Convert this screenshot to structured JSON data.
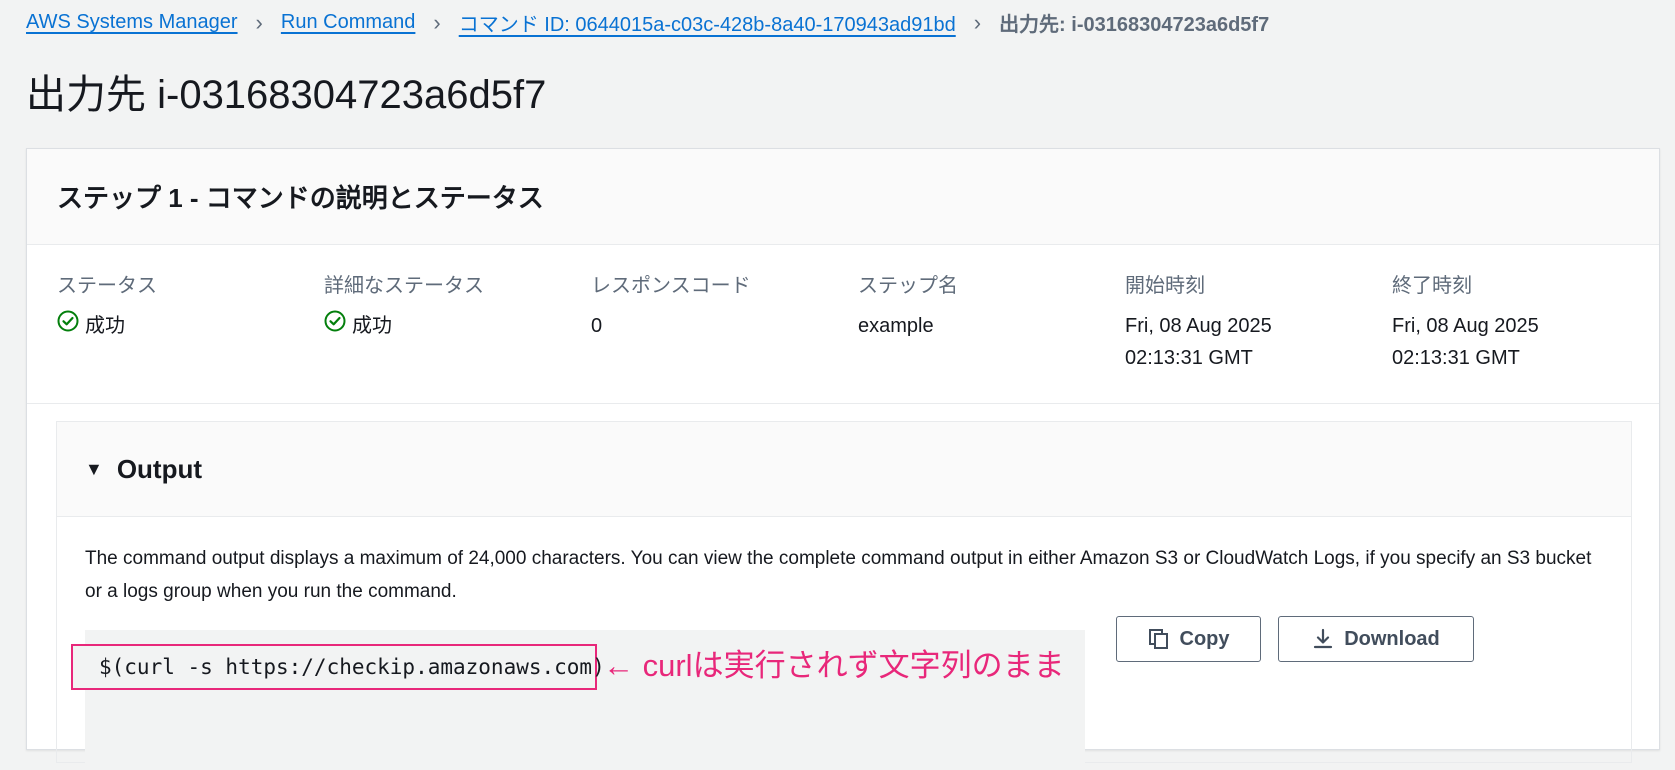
{
  "breadcrumb": {
    "items": [
      "AWS Systems Manager",
      "Run Command",
      "コマンド ID: 0644015a-c03c-428b-8a40-170943ad91bd"
    ],
    "current": "出力先: i-03168304723a6d5f7"
  },
  "page_title": "出力先 i-03168304723a6d5f7",
  "step": {
    "title": "ステップ 1 - コマンドの説明とステータス",
    "fields": [
      {
        "label": "ステータス",
        "value": "成功"
      },
      {
        "label": "詳細なステータス",
        "value": "成功"
      },
      {
        "label": "レスポンスコード",
        "value": "0"
      },
      {
        "label": "ステップ名",
        "value": "example"
      },
      {
        "label": "開始時刻",
        "value_line1": "Fri, 08 Aug 2025",
        "value_line2": "02:13:31 GMT"
      },
      {
        "label": "終了時刻",
        "value_line1": "Fri, 08 Aug 2025",
        "value_line2": "02:13:31 GMT"
      }
    ]
  },
  "output": {
    "title": "Output",
    "description": "The command output displays a maximum of 24,000 characters. You can view the complete command output in either Amazon S3 or CloudWatch Logs, if you specify an S3 bucket or a logs group when you run the command.",
    "code": "$(curl -s https://checkip.amazonaws.com)",
    "annotation": "← curlは実行されず文字列のまま",
    "copy_label": "Copy",
    "download_label": "Download"
  },
  "colors": {
    "link": "#0972d3",
    "success": "#037f0c",
    "annotation": "#e8277a"
  },
  "icons": [
    "chevron-right-icon",
    "status-success-icon",
    "caret-down-icon",
    "copy-icon",
    "download-icon"
  ]
}
